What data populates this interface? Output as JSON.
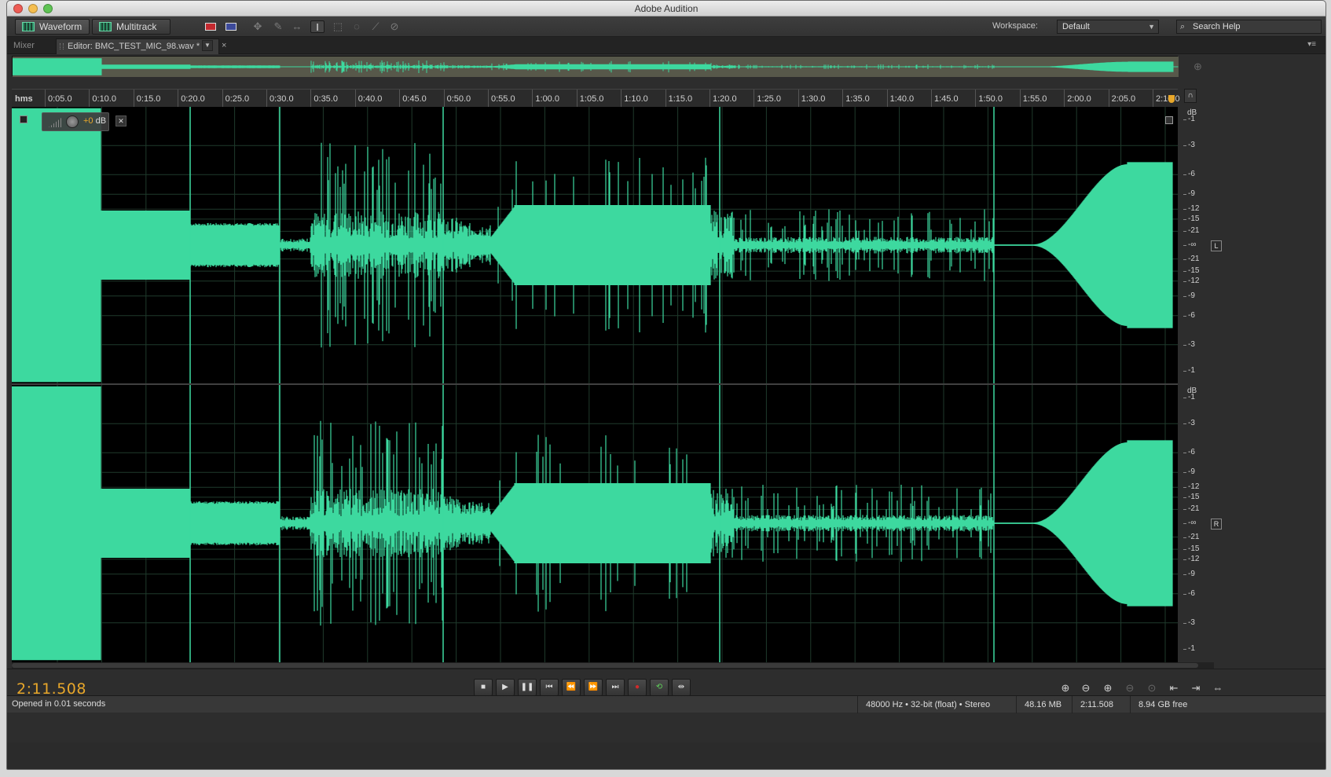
{
  "window": {
    "title": "Adobe Audition"
  },
  "toolbar": {
    "waveform_label": "Waveform",
    "multitrack_label": "Multitrack",
    "workspace_label": "Workspace:",
    "workspace_value": "Default",
    "search_placeholder": "Search Help"
  },
  "tabs": {
    "mixer": "Mixer",
    "editor": "Editor: BMC_TEST_MIC_98.wav *"
  },
  "ruler": {
    "unit": "hms",
    "ticks": [
      "0:05.0",
      "0:10.0",
      "0:15.0",
      "0:20.0",
      "0:25.0",
      "0:30.0",
      "0:35.0",
      "0:40.0",
      "0:45.0",
      "0:50.0",
      "0:55.0",
      "1:00.0",
      "1:05.0",
      "1:10.0",
      "1:15.0",
      "1:20.0",
      "1:25.0",
      "1:30.0",
      "1:35.0",
      "1:40.0",
      "1:45.0",
      "1:50.0",
      "1:55.0",
      "2:00.0",
      "2:05.0",
      "2:10.0"
    ]
  },
  "hud": {
    "value": "+0",
    "unit": "dB"
  },
  "db_scale": {
    "unit": "dB",
    "left_channel": [
      "-1",
      "-3",
      "-6",
      "-9",
      "-12",
      "-15",
      "-21",
      "-∞",
      "-21",
      "-15",
      "-12",
      "-9",
      "-6",
      "-3",
      "-1"
    ],
    "right_channel": [
      "-1",
      "-3",
      "-6",
      "-9",
      "-12",
      "-15",
      "-21",
      "-∞",
      "-21",
      "-15",
      "-12",
      "-9",
      "-6",
      "-3",
      "-1"
    ],
    "left_label": "L",
    "right_label": "R"
  },
  "transport": {
    "timecode": "2:11.508"
  },
  "status": {
    "message": "Opened in 0.01 seconds",
    "format": "48000 Hz • 32-bit (float) • Stereo",
    "size": "48.16 MB",
    "duration": "2:11.508",
    "free": "8.94 GB free"
  },
  "colors": {
    "waveform": "#3dd99f",
    "timecode": "#e8a72a",
    "background": "#000000"
  }
}
